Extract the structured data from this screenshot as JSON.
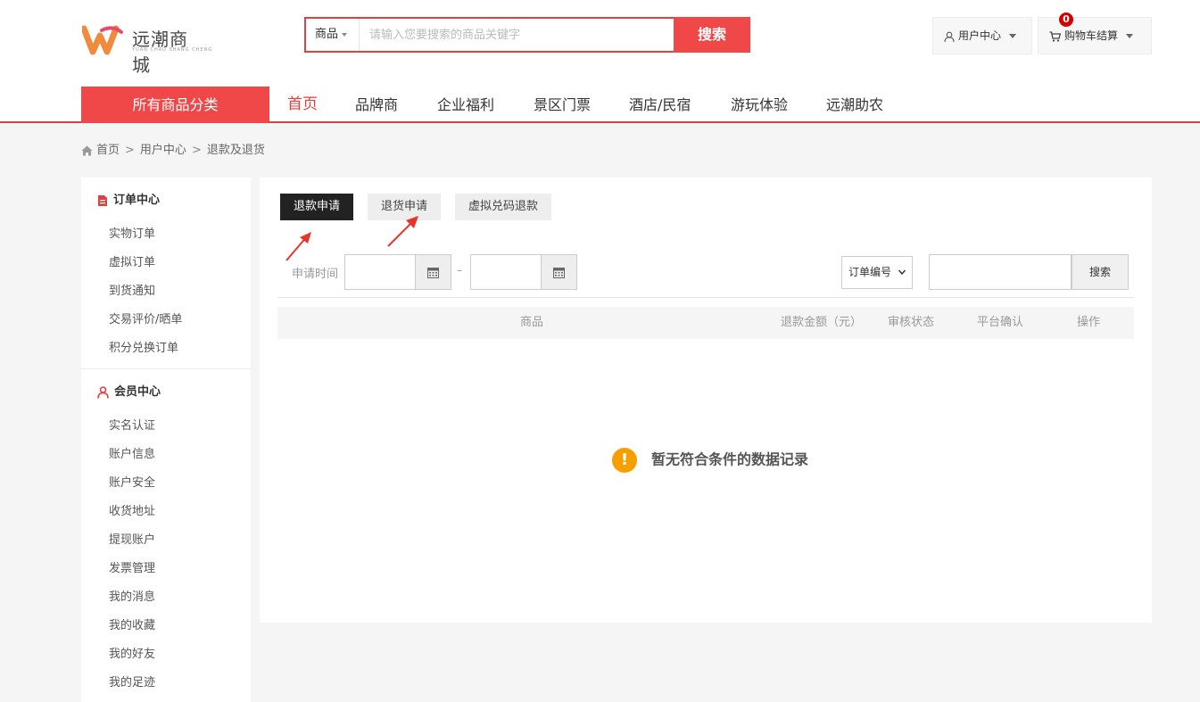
{
  "brand": {
    "name": "远潮商城",
    "sub": "YUAN CHAO SHANG CHENG",
    "accent": "#e2403f"
  },
  "search": {
    "category": "商品",
    "placeholder": "请输入您要搜索的商品关键字",
    "button": "搜索"
  },
  "topbar": {
    "user_center": "用户中心",
    "cart": "购物车结算",
    "cart_count": "0"
  },
  "nav": {
    "all_categories": "所有商品分类",
    "items": [
      "首页",
      "品牌商",
      "企业福利",
      "景区门票",
      "酒店/民宿",
      "游玩体验",
      "远潮助农"
    ],
    "active": "首页"
  },
  "breadcrumb": [
    "首页",
    "用户中心",
    "退款及退货"
  ],
  "sidebar": {
    "order_center": {
      "title": "订单中心",
      "items": [
        "实物订单",
        "虚拟订单",
        "到货通知",
        "交易评价/晒单",
        "积分兑换订单"
      ]
    },
    "member_center": {
      "title": "会员中心",
      "items": [
        "实名认证",
        "账户信息",
        "账户安全",
        "收货地址",
        "提现账户",
        "发票管理",
        "我的消息",
        "我的收藏",
        "我的好友",
        "我的足迹"
      ]
    }
  },
  "tabs": [
    "退款申请",
    "退货申请",
    "虚拟兑码退款"
  ],
  "filter": {
    "date_label": "申请时间",
    "date_sep": "–",
    "select_value": "订单编号",
    "search_button": "搜索"
  },
  "table": {
    "headers": [
      "商品",
      "退款金额（元）",
      "审核状态",
      "平台确认",
      "操作"
    ]
  },
  "empty_message": "暂无符合条件的数据记录"
}
